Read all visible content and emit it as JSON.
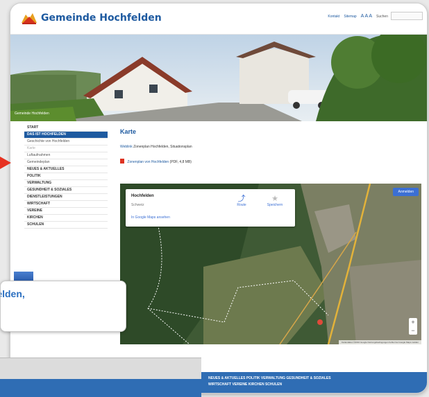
{
  "header": {
    "brand": "Gemeinde Hochfelden",
    "links": [
      "Kontakt",
      "Sitemap"
    ],
    "font_size_label": "A A A",
    "search_label": "Suchen"
  },
  "hero": {
    "caption": "Gemeinde Hochfelden"
  },
  "sidebar": {
    "items": [
      {
        "label": "START",
        "state": "normal"
      },
      {
        "label": "DAS IST HOCHFELDEN",
        "state": "active"
      },
      {
        "label": "Geschichte von Hochfelden",
        "state": "sub"
      },
      {
        "label": "Karte",
        "state": "current"
      },
      {
        "label": "Luftaufnahmen",
        "state": "sub"
      },
      {
        "label": "Gemeindeplan",
        "state": "sub"
      },
      {
        "label": "NEUES & AKTUELLES",
        "state": "normal"
      },
      {
        "label": "POLITIK",
        "state": "normal"
      },
      {
        "label": "VERWALTUNG",
        "state": "normal"
      },
      {
        "label": "GESUNDHEIT & SOZIALES",
        "state": "normal"
      },
      {
        "label": "DIENSTLEISTUNGEN",
        "state": "normal"
      },
      {
        "label": "WIRTSCHAFT",
        "state": "normal"
      },
      {
        "label": "VEREINE",
        "state": "normal"
      },
      {
        "label": "KIRCHEN",
        "state": "normal"
      },
      {
        "label": "SCHULEN",
        "state": "normal"
      }
    ]
  },
  "main": {
    "title": "Karte",
    "intro_link": "Weblink",
    "intro_text": "Zonenplan Hochfelden, Situationsplan",
    "pdf_link": "Zonenplan von Hochfelden",
    "pdf_meta": "(PDF, 4,8 MB)"
  },
  "map": {
    "popup_title": "Hochfelden",
    "popup_sub": "Schweiz",
    "popup_link": "In Google Maps ansehen",
    "route_button": "Route",
    "save_button": "Speichern",
    "top_right_button": "Anmelden",
    "attribution": "Kartendaten ©2016 Google Nutzungsbedingungen Fehler bei Google Maps melden",
    "zoom_in": "+",
    "zoom_out": "−"
  },
  "footer": {
    "line1": "NEUES & AKTUELLES   POLITIK   VERWALTUNG   GESUNDHEIT & SOZIALES",
    "line2": "WIRTSCHAFT   VEREINE   KIRCHEN   SCHULEN"
  },
  "callout": {
    "text": "Zonenplan Hochfelden,"
  },
  "colors": {
    "brand": "#1e5aa0",
    "arrow": "#e63222",
    "footer": "#2f6db4"
  }
}
